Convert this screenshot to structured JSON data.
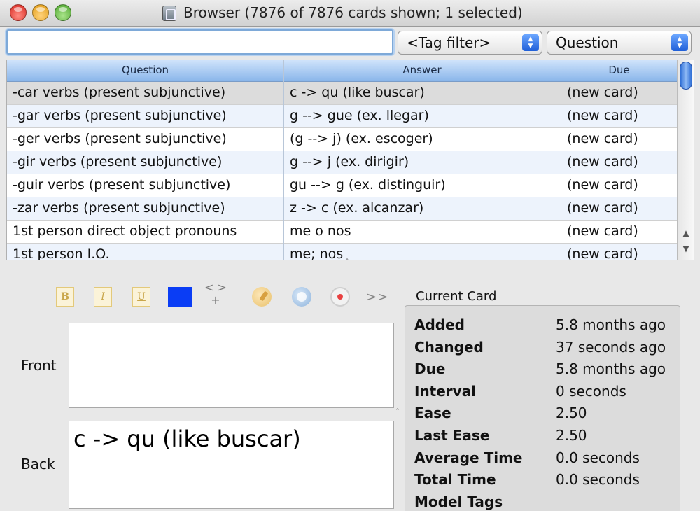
{
  "window": {
    "title": "Browser (7876 of 7876 cards shown; 1 selected)"
  },
  "search": {
    "value": "",
    "placeholder": ""
  },
  "tag_filter": {
    "selected": "<Tag filter>"
  },
  "field_filter": {
    "selected": "Question"
  },
  "table": {
    "headers": [
      "Question",
      "Answer",
      "Due"
    ],
    "rows": [
      {
        "question": "-car verbs (present subjunctive)",
        "answer": "c -> qu (like buscar)",
        "due": "(new card)"
      },
      {
        "question": "-gar verbs (present subjunctive)",
        "answer": "g --> gue (ex. llegar)",
        "due": "(new card)"
      },
      {
        "question": "-ger verbs (present subjunctive)",
        "answer": "(g --> j) (ex. escoger)",
        "due": "(new card)"
      },
      {
        "question": "-gir verbs (present subjunctive)",
        "answer": "g --> j (ex. dirigir)",
        "due": "(new card)"
      },
      {
        "question": "-guir verbs (present subjunctive)",
        "answer": "gu --> g (ex. distinguir)",
        "due": "(new card)"
      },
      {
        "question": "-zar verbs (present subjunctive)",
        "answer": "z -> c (ex. alcanzar)",
        "due": "(new card)"
      },
      {
        "question": "1st person direct object pronouns",
        "answer": "me o nos",
        "due": "(new card)"
      },
      {
        "question": "1st person I.O.",
        "answer": "me; nos",
        "due": "(new card)"
      }
    ]
  },
  "toolbar": {
    "bold_label": "B",
    "italic_label": "I",
    "underline_label": "U",
    "text_color": "#0a3df5",
    "cloze_label": "< >",
    "cloze_sub": "+",
    "more_label": ">>",
    "icons": [
      "palette-icon",
      "globe-icon",
      "record-icon"
    ]
  },
  "editor": {
    "front_label": "Front",
    "front_value": "",
    "back_label": "Back",
    "back_value": "c -> qu (like buscar)"
  },
  "current_card": {
    "title": "Current Card",
    "stats": [
      {
        "label": "Added",
        "value": "5.8 months ago"
      },
      {
        "label": "Changed",
        "value": "37 seconds ago"
      },
      {
        "label": "Due",
        "value": "5.8 months ago"
      },
      {
        "label": "Interval",
        "value": "0 seconds"
      },
      {
        "label": "Ease",
        "value": "2.50"
      },
      {
        "label": "Last Ease",
        "value": "2.50"
      },
      {
        "label": "Average Time",
        "value": "0.0 seconds"
      },
      {
        "label": "Total Time",
        "value": "0.0 seconds"
      },
      {
        "label": "Model Tags",
        "value": ""
      }
    ]
  }
}
